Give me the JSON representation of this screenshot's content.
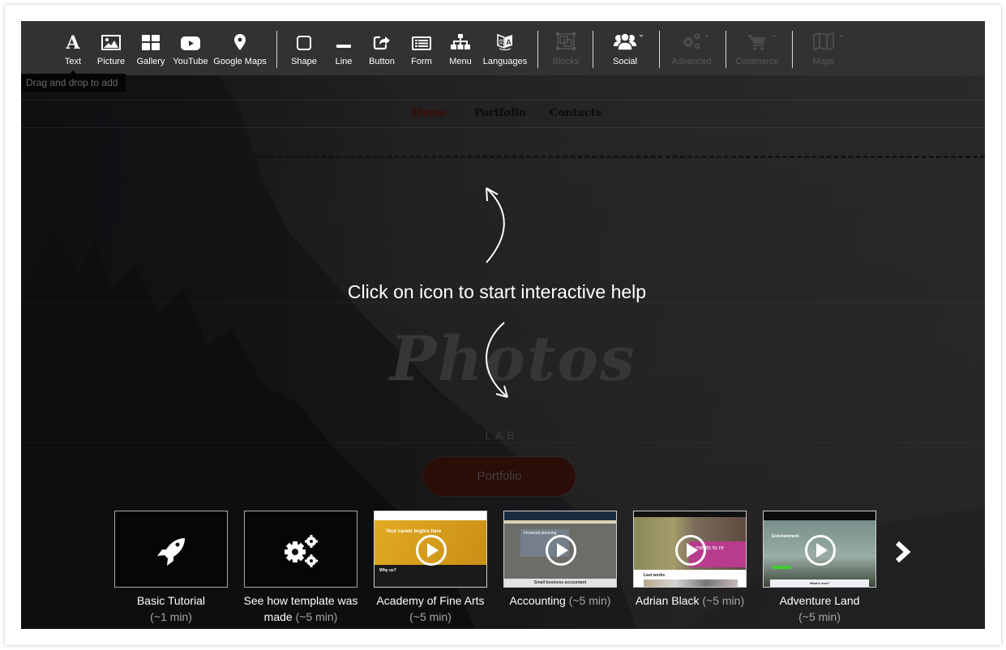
{
  "toolbar": {
    "tools": [
      {
        "label": "Text",
        "icon": "text-icon",
        "enabled": true
      },
      {
        "label": "Picture",
        "icon": "picture-icon",
        "enabled": true
      },
      {
        "label": "Gallery",
        "icon": "gallery-icon",
        "enabled": true
      },
      {
        "label": "YouTube",
        "icon": "youtube-icon",
        "enabled": true
      },
      {
        "label": "Google Maps",
        "icon": "map-pin-icon",
        "enabled": true
      },
      {
        "label": "Shape",
        "icon": "shape-icon",
        "enabled": true
      },
      {
        "label": "Line",
        "icon": "line-icon",
        "enabled": true
      },
      {
        "label": "Button",
        "icon": "button-icon",
        "enabled": true
      },
      {
        "label": "Form",
        "icon": "form-icon",
        "enabled": true
      },
      {
        "label": "Menu",
        "icon": "menu-icon",
        "enabled": true
      },
      {
        "label": "Languages",
        "icon": "languages-icon",
        "enabled": true
      },
      {
        "label": "Blocks",
        "icon": "blocks-icon",
        "enabled": false
      },
      {
        "label": "Social",
        "icon": "social-icon",
        "enabled": true
      },
      {
        "label": "Advanced",
        "icon": "gears-icon",
        "enabled": false
      },
      {
        "label": "Commerce",
        "icon": "cart-icon",
        "enabled": false
      },
      {
        "label": "Maps",
        "icon": "folded-map-icon",
        "enabled": false
      }
    ],
    "tooltip": "Drag and drop to add"
  },
  "site": {
    "nav": [
      "Home",
      "Portfolio",
      "Contacts"
    ],
    "active_nav": "Home",
    "hero_title": "Photos",
    "hero_subtitle": "LAB",
    "cta_label": "Portfolio"
  },
  "help": {
    "text": "Click on icon to start interactive help"
  },
  "tutorials": [
    {
      "title": "Basic Tutorial",
      "duration": "(~1 min)",
      "icon": "rocket-icon"
    },
    {
      "title": "See how template was made",
      "duration": "(~5 min)",
      "icon": "gears-icon"
    },
    {
      "title": "Academy of Fine Arts",
      "duration": "(~5 min)",
      "thumb_heading": "Your career begins here",
      "thumb_section": "Why us?"
    },
    {
      "title": "Accounting",
      "duration": "(~5 min)",
      "thumb_heading": "Financial planning",
      "thumb_footer": "Small business accountant"
    },
    {
      "title": "Adrian Black",
      "duration": "(~5 min)",
      "thumb_heading": "ments to re",
      "thumb_section": "Last works"
    },
    {
      "title": "Adventure Land",
      "duration": "(~5 min)",
      "thumb_heading": "Entertainment",
      "thumb_footer": "What's new?"
    }
  ],
  "colors": {
    "toolbar_bg": "#323232",
    "nav_active": "#3d0a06",
    "cta_bg": "#2b0d07",
    "academy_yellow": "#d9a21d",
    "accounting_navy": "#1d2b3f",
    "adrian_pink": "#b83b8e"
  }
}
